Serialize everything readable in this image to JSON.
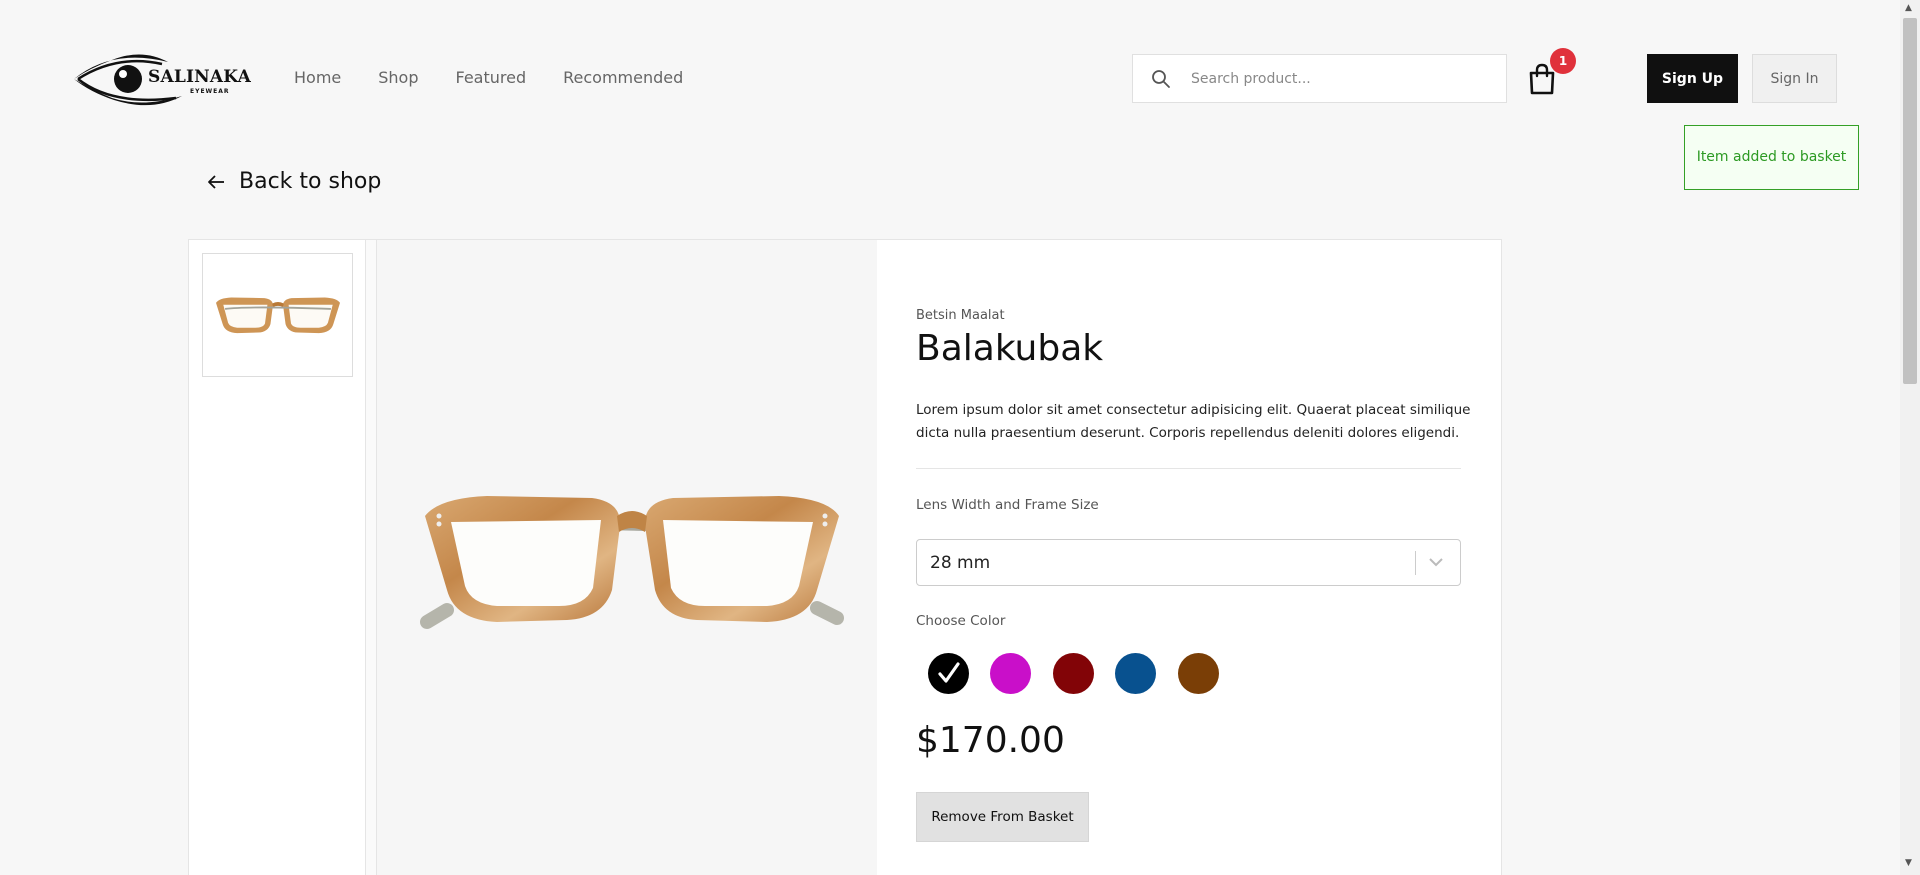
{
  "brand": {
    "logo_name": "SALINAKA",
    "logo_sub": "EYEWEAR"
  },
  "nav": {
    "items": [
      {
        "label": "Home"
      },
      {
        "label": "Shop"
      },
      {
        "label": "Featured"
      },
      {
        "label": "Recommended"
      }
    ]
  },
  "search": {
    "placeholder": "Search product...",
    "value": "",
    "icon": "search-icon"
  },
  "basket": {
    "icon": "shopping-bag-icon",
    "count": "1"
  },
  "auth": {
    "signup_label": "Sign Up",
    "signin_label": "Sign In"
  },
  "toast": {
    "message": "Item added to basket"
  },
  "back": {
    "label": "Back to shop",
    "icon": "arrow-left-icon"
  },
  "product": {
    "brand": "Betsin Maalat",
    "name": "Balakubak",
    "description": "Lorem ipsum dolor sit amet consectetur adipisicing elit. Quaerat placeat similique dicta nulla praesentium deserunt. Corporis repellendus deleniti dolores eligendi.",
    "size_label": "Lens Width and Frame Size",
    "size_selected": "28 mm",
    "color_label": "Choose Color",
    "colors": [
      {
        "name": "black",
        "hex": "#000000",
        "selected": true
      },
      {
        "name": "magenta",
        "hex": "#c90fc9",
        "selected": false
      },
      {
        "name": "maroon",
        "hex": "#820407",
        "selected": false
      },
      {
        "name": "blue",
        "hex": "#08518f",
        "selected": false
      },
      {
        "name": "brown",
        "hex": "#7a3e06",
        "selected": false
      }
    ],
    "price": "$170.00",
    "remove_label": "Remove From Basket"
  },
  "colors": {
    "accent_dark": "#101010",
    "badge_red": "#e0313b",
    "toast_green": "#2c9a23"
  }
}
